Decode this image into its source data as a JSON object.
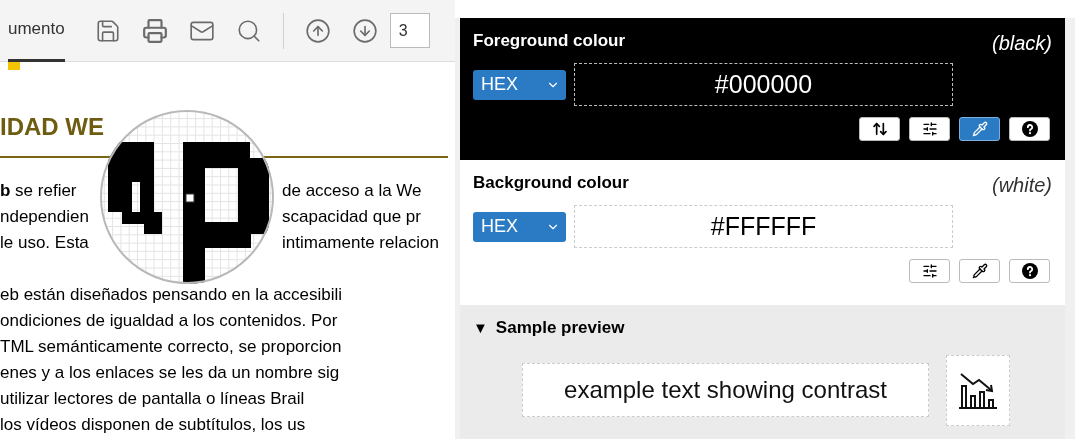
{
  "document": {
    "toolbar": {
      "tab": {
        "label": "umento",
        "selected": true
      },
      "tools": [
        {
          "kind": "save"
        },
        {
          "kind": "print"
        },
        {
          "kind": "mail"
        },
        {
          "kind": "search"
        },
        {
          "kind": "separator"
        },
        {
          "kind": "up"
        },
        {
          "kind": "down"
        }
      ],
      "page_field": {
        "value": "3"
      }
    },
    "heading": "IDAD WE",
    "lines_partial": [
      {
        "left": "**b** se refier",
        "right": "de acceso a la We"
      },
      {
        "left": "ndependien",
        "right": "scapacidad que pr"
      },
      {
        "left": "le uso. Esta",
        "right": "intimamente relacion"
      }
    ],
    "lines": [
      "eb están diseñados pensando en la accesibili",
      "ondiciones de igualdad a los contenidos. Por",
      "TML semánticamente correcto, se proporcion",
      "enes y a los enlaces se les da un nombre sig",
      "utilizar lectores de pantalla o líneas Brail",
      "los vídeos disponen de subtítulos, los us"
    ]
  },
  "cca": {
    "sections": [
      {
        "title": "Foreground colour",
        "name": "(black)",
        "kind": "dark",
        "format": "HEX",
        "value": "#000000",
        "buttons": [
          {
            "kind": "swap",
            "active": false
          },
          {
            "kind": "adjust",
            "active": false
          },
          {
            "kind": "pick",
            "active": true
          },
          {
            "kind": "help",
            "active": false
          }
        ]
      },
      {
        "title": "Background colour",
        "name": "(white)",
        "kind": "light",
        "format": "HEX",
        "value": "#FFFFFF",
        "buttons": [
          {
            "kind": "adjust",
            "active": false
          },
          {
            "kind": "pick",
            "active": false
          },
          {
            "kind": "help",
            "active": false
          }
        ]
      }
    ],
    "preview": {
      "title": "Sample preview",
      "toggle": "▼",
      "expanded": true,
      "sample": "example text showing contrast"
    }
  }
}
